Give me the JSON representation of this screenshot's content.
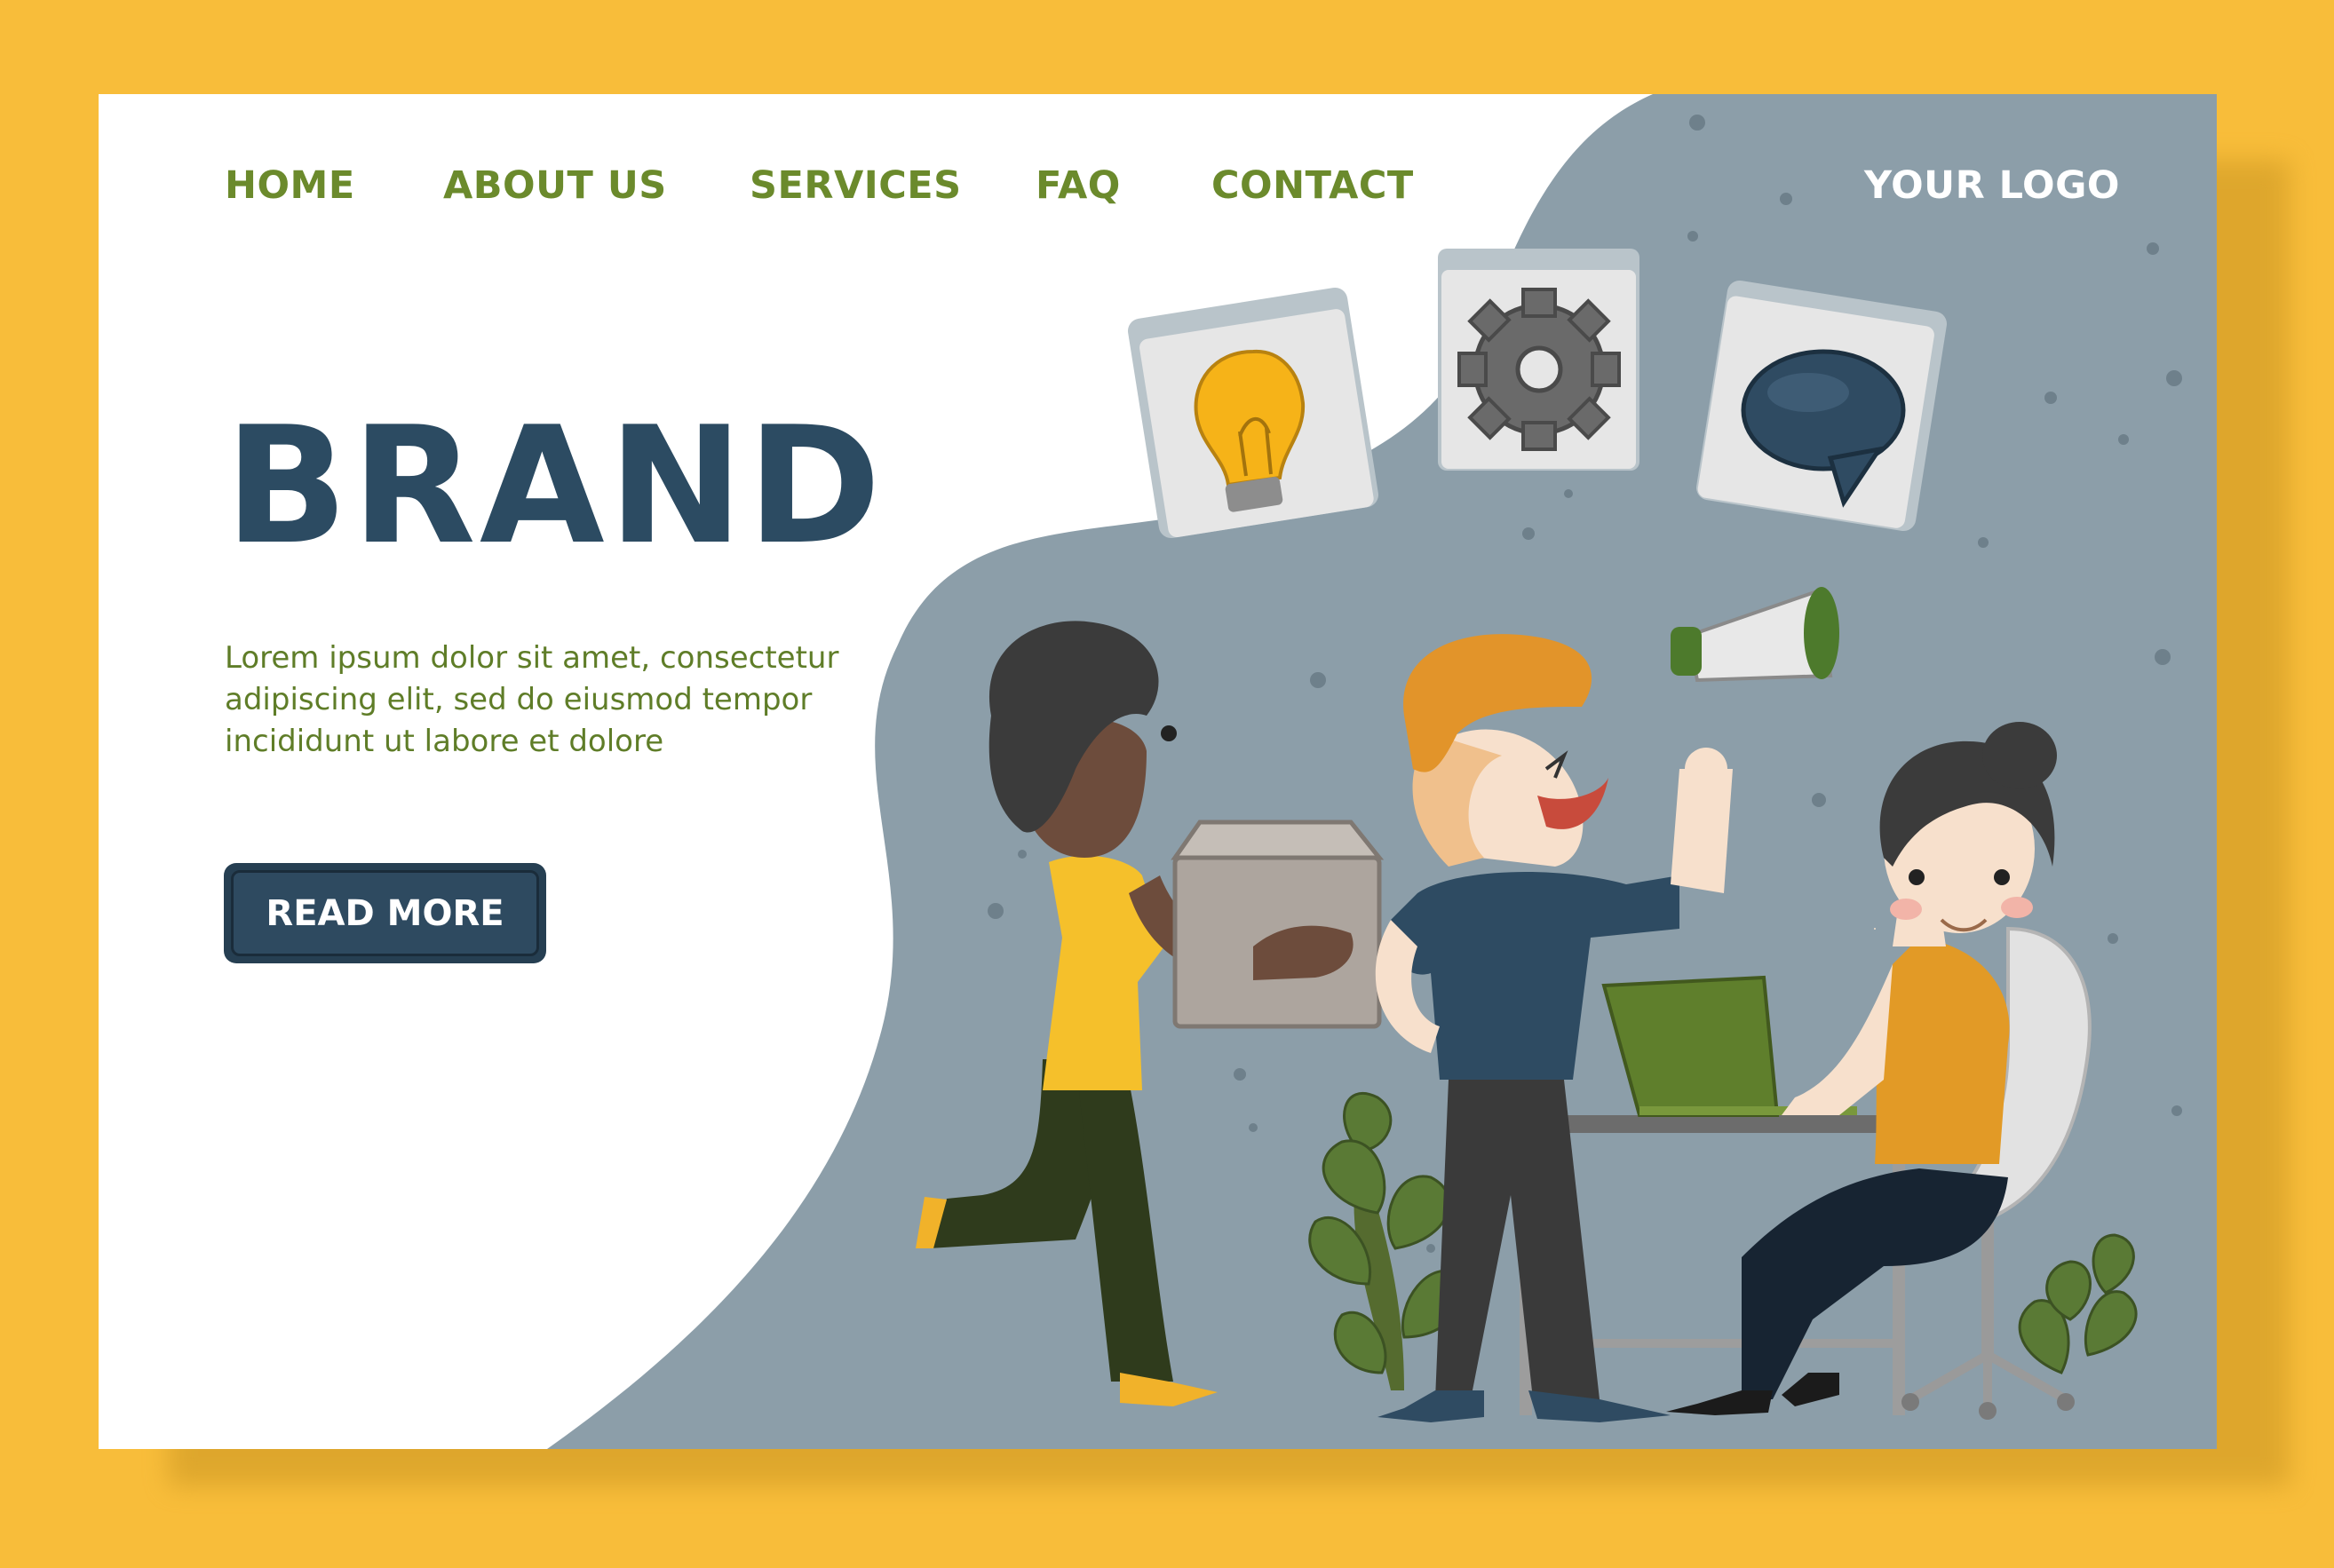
{
  "nav": {
    "items": [
      {
        "label": "HOME"
      },
      {
        "label": "ABOUT US"
      },
      {
        "label": "SERVICES"
      },
      {
        "label": "FAQ"
      },
      {
        "label": "CONTACT"
      }
    ],
    "logo": "YOUR LOGO"
  },
  "hero": {
    "title": "BRAND",
    "body_lines": [
      "Lorem ipsum dolor sit amet, consectetur",
      "adipiscing elit, sed do eiusmod tempor",
      "incididunt ut labore et dolore"
    ],
    "cta_label": "READ MORE"
  },
  "illustration": {
    "icons": [
      "lightbulb-icon",
      "gear-icon",
      "speech-bubble-icon"
    ],
    "figures": [
      "person-carrying-box",
      "person-with-megaphone",
      "person-at-laptop"
    ]
  },
  "colors": {
    "background": "#f8bd3a",
    "page": "#ffffff",
    "blob": "#8c9ea9",
    "nav_text": "#6b8a2c",
    "title": "#2c4b62",
    "body_text": "#5f7d28",
    "button": "#263f52"
  }
}
